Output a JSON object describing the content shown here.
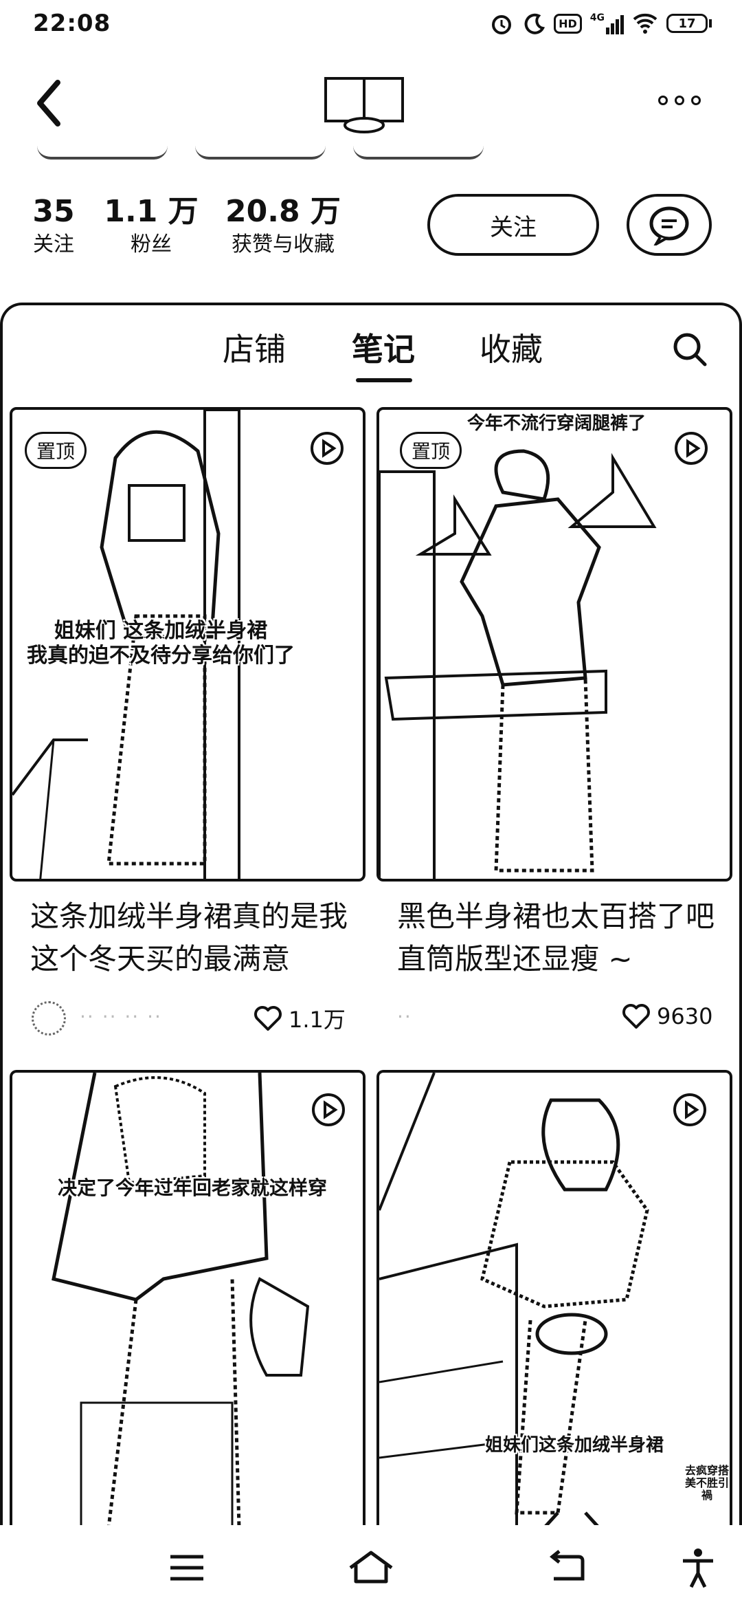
{
  "status_bar": {
    "time": "22:08",
    "network": "4G",
    "hd": "HD",
    "battery": "17"
  },
  "header": {
    "back_icon": "chevron-left-icon",
    "more_icon": "more-dots-icon"
  },
  "stats": {
    "following_count": "35",
    "following_label": "关注",
    "fans_count": "1.1 万",
    "fans_label": "粉丝",
    "likes_count": "20.8 万",
    "likes_label": "获赞与收藏"
  },
  "actions": {
    "follow_label": "关注",
    "chat_icon": "chat-bubble-icon"
  },
  "tabs": [
    {
      "label": "店铺",
      "active": false
    },
    {
      "label": "笔记",
      "active": true
    },
    {
      "label": "收藏",
      "active": false
    }
  ],
  "notes": [
    {
      "pin": "置顶",
      "caption": "姐妹们 这条加绒半身裙\n我真的迫不及待分享给你们了",
      "title": "这条加绒半身裙真的是我这个冬天买的最满意",
      "likes": "1.1万",
      "is_video": true
    },
    {
      "pin": "置顶",
      "caption": "今年不流行穿阔腿裤了",
      "title": "黑色半身裙也太百搭了吧 直筒版型还显瘦 ~",
      "likes": "9630",
      "is_video": true
    },
    {
      "caption": "决定了今年过年回老家就这样穿",
      "is_video": true
    },
    {
      "caption": "姐妹们这条加绒半身裙",
      "badge": "去疯穿搭\n美不胜引禍",
      "is_video": true
    }
  ],
  "navbar": {
    "menu_icon": "menu-icon",
    "home_icon": "home-icon",
    "back_icon": "back-arrow-icon",
    "accessibility_icon": "accessibility-icon"
  }
}
